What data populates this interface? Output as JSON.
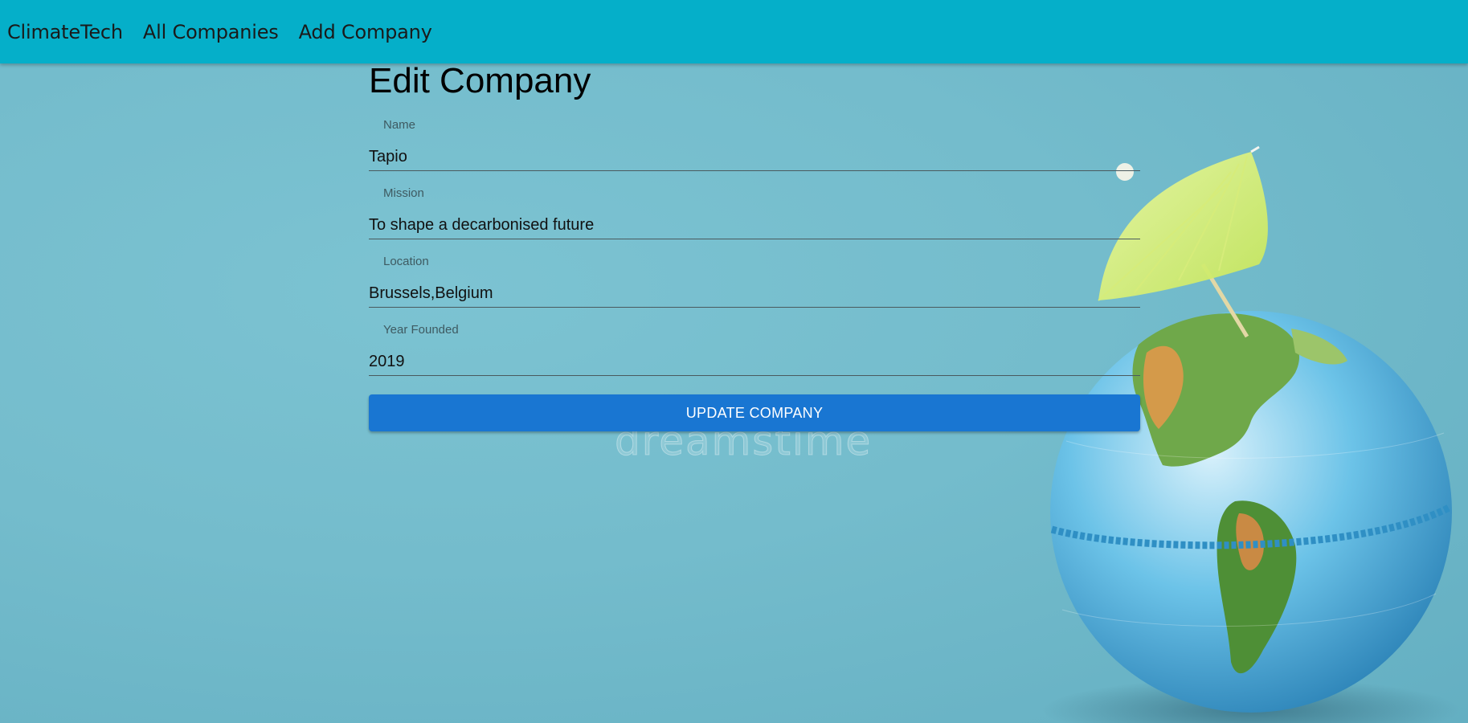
{
  "nav": {
    "brand": "ClimateTech",
    "links": [
      "All Companies",
      "Add Company"
    ]
  },
  "page": {
    "title": "Edit Company"
  },
  "form": {
    "fields": [
      {
        "label": "Name",
        "value": "Tapio"
      },
      {
        "label": "Mission",
        "value": "To shape a decarbonised future"
      },
      {
        "label": "Location",
        "value": "Brussels,Belgium"
      },
      {
        "label": "Year Founded",
        "value": "2019"
      }
    ],
    "submit_label": "UPDATE COMPANY"
  },
  "background": {
    "watermark": "dreamstime"
  },
  "colors": {
    "navbar": "#05afc9",
    "button": "#1976d2",
    "background": "#74bccc"
  }
}
